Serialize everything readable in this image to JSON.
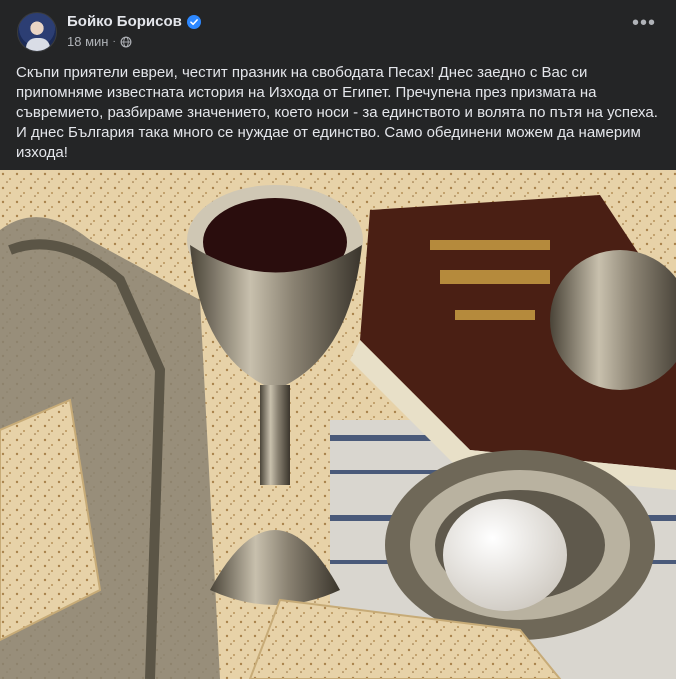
{
  "post": {
    "author": "Бойко Борисов",
    "verified": true,
    "time": "18 мин",
    "privacy_icon": "globe-icon",
    "more_icon": "more-options-icon",
    "text": "Скъпи приятели евреи, честит празник на свободата Песах! Днес заедно с Вас си припомняме известната история на Изхода от Египет. Пречупена през призмата на съвремието, разбираме значението, което носи - за единството и волята по пътя на успеха. И днес България така много се нуждае от единство. Само обединени можем да намерим изхода!"
  },
  "colors": {
    "background": "#242526",
    "text": "#e4e6eb",
    "secondary_text": "#b0b3b8",
    "verified_badge": "#2d88ff"
  }
}
